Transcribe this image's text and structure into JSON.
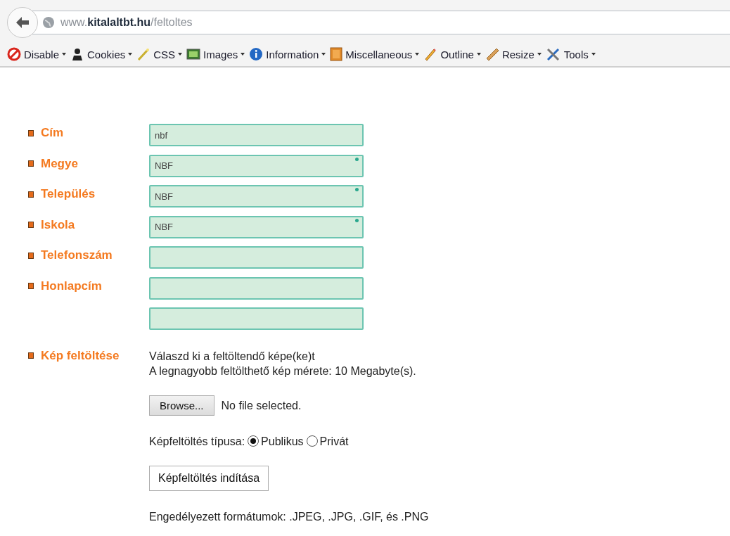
{
  "address_bar": {
    "url": "www.**kitalaltbt.hu**/feltoltes"
  },
  "toolbar": [
    {
      "label": "Disable"
    },
    {
      "label": "Cookies"
    },
    {
      "label": "CSS"
    },
    {
      "label": "Images"
    },
    {
      "label": "Information"
    },
    {
      "label": "Miscellaneous"
    },
    {
      "label": "Outline"
    },
    {
      "label": "Resize"
    },
    {
      "label": "Tools"
    }
  ],
  "form": {
    "fields": [
      {
        "label": "Cím",
        "value": "nbf",
        "required": false
      },
      {
        "label": "Megye",
        "value": "NBF",
        "required": true
      },
      {
        "label": "Település",
        "value": "NBF",
        "required": true
      },
      {
        "label": "Iskola",
        "value": "NBF",
        "required": true
      },
      {
        "label": "Telefonszám",
        "required": false
      },
      {
        "label": "Honlapcím",
        "required": false
      },
      {
        "required": false
      }
    ],
    "upload": {
      "label": "Kép feltöltése",
      "instruction": "Válaszd ki a feltöltendő képe(ke)t",
      "max_size": "A legnagyobb feltölthető kép mérete: 10 Megabyte(s).",
      "browse_button": "Browse...",
      "file_status": "No file selected.",
      "type_label": "Képfeltöltés típusa:",
      "type_options": [
        {
          "label": "Publikus",
          "selected": true
        },
        {
          "label": "Privát",
          "selected": false
        }
      ],
      "submit_button": "Képfeltöltés indítása",
      "formats": "Engedélyezett formátumok: .JPEG, .JPG, .GIF, és .PNG"
    }
  }
}
